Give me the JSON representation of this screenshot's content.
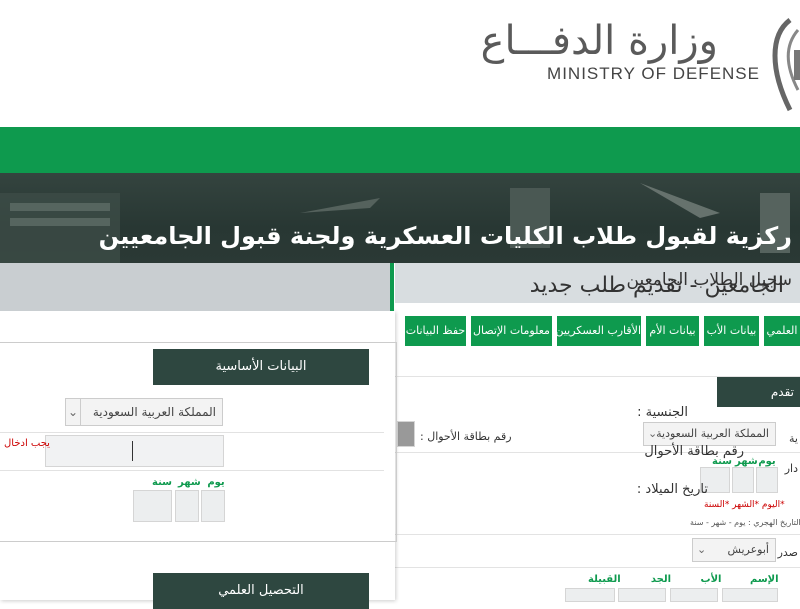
{
  "header": {
    "logo_ar": "وزارة الدفـــاع",
    "logo_en": "MINISTRY OF DEFENSE",
    "banner_text": "ركزية لقبول طلاب الكليات العسكرية ولجنة قبول الجامعيين"
  },
  "back_panel": {
    "title": "سجيل الطلاب الجامعين",
    "tabs": [
      "العلمي",
      "بيانات الأب",
      "بيانات الأم",
      "الأقارب العسكريين",
      "معلومات الإتصال",
      "حفظ البيانات"
    ],
    "section": "تقدم",
    "nationality_label": "ية",
    "nationality_value": "المملكة العربية السعودية",
    "id_label": "رقم بطاقة الأحوال :",
    "issue_label": "دار",
    "day": "يوم",
    "month": "شهر",
    "year": "سنة",
    "date_hint": "*اليوم *الشهر *السنة",
    "hijri_hint": "التاريخ الهجري : يوم - شهر - سنة",
    "source_label": "صدر",
    "source_value": "أبوعريش",
    "name_cols": [
      "الإسم",
      "الأب",
      "الجد",
      "القبيلة"
    ]
  },
  "front_panel": {
    "title": "الجامعين - تقديم طلب جديد",
    "section_basic": "البيانات الأساسية",
    "nationality_label": "الجنسية :",
    "nationality_value": "المملكة العربية السعودية",
    "id_label": "رقم بطاقة الأحوال",
    "id_value": "",
    "error": "يجب ادخال",
    "dob_label": "تاريخ الميلاد :",
    "day": "يوم",
    "month": "شهر",
    "year": "سنة",
    "section_edu": "التحصيل العلمي"
  },
  "colors": {
    "green": "#0e9a4e",
    "dark": "#2e4740"
  }
}
